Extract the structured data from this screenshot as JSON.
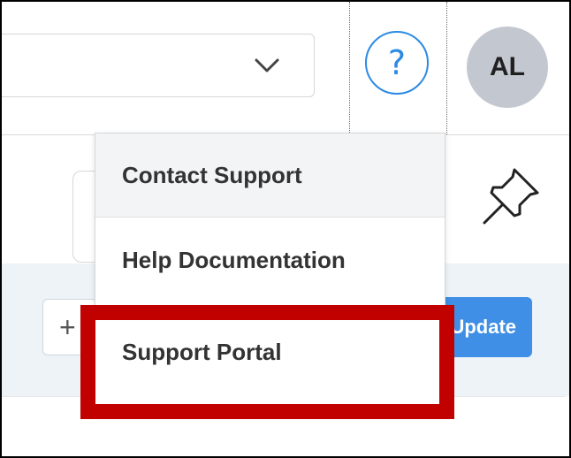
{
  "header": {
    "help_symbol": "?",
    "avatar_initials": "AL"
  },
  "toolbar": {
    "plus_symbol": "+",
    "update_label": "Update"
  },
  "help_menu": {
    "items": [
      {
        "label": "Contact Support"
      },
      {
        "label": "Help Documentation"
      },
      {
        "label": "Support Portal"
      }
    ]
  },
  "colors": {
    "accent_blue": "#2b8ae5",
    "button_blue": "#3f8fe6",
    "highlight_red": "#c10000",
    "avatar_gray": "#c3c7d0"
  },
  "icons": [
    "chevron-down-icon",
    "help-icon",
    "pin-icon",
    "plus-icon"
  ]
}
